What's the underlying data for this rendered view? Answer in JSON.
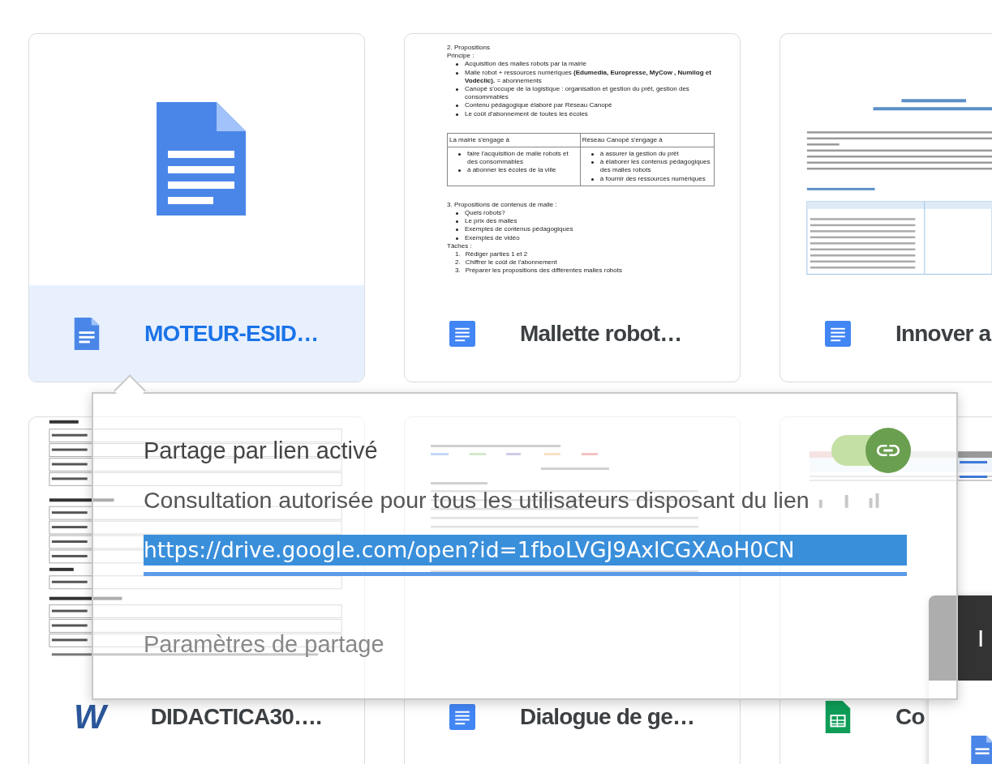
{
  "cards": [
    {
      "title": "MOTEUR-ESID…",
      "kind": "doc_file",
      "selected": true,
      "thumbnail": {
        "kind": "icon"
      }
    },
    {
      "title": "Mallette robot…",
      "kind": "docs",
      "selected": false,
      "thumbnail": {
        "kind": "document",
        "blocks": [
          {
            "kind": "text",
            "text": "2. Propositions"
          },
          {
            "kind": "text",
            "text": "Principe :"
          },
          {
            "kind": "bullet",
            "text": "Acquisition des malles robots par la mairie"
          },
          {
            "kind": "bullet",
            "text": "Malle robot + ressources numériques **(Edumedia, Europresse, MyCow , Numilog et Vodéclic).** = abonnements"
          },
          {
            "kind": "bullet",
            "text": "Canopé s'occupe de la logistique : organisation et gestion du prêt, gestion des consommables"
          },
          {
            "kind": "bullet",
            "text": "Contenu pédagogique élaboré par Réseau Canopé"
          },
          {
            "kind": "bullet",
            "text": "Le coût d'abonnement de toutes les écoles"
          },
          {
            "kind": "table",
            "header": [
              "La mairie s'engage à",
              "Réseau Canopé s'engage à"
            ],
            "rows": [
              [
                {
                  "bullets": [
                    "faire l'acquisition de malle robots et des consommables",
                    "à abonner les écoles de la ville"
                  ]
                },
                {
                  "bullets": [
                    "à assurer la gestion du prêt",
                    "à élaborer les contenus pédagogiques des malles robots",
                    "à fournir des ressources numériques"
                  ]
                }
              ]
            ]
          },
          {
            "kind": "text",
            "text": "3. Propositions de contenus de malle :"
          },
          {
            "kind": "bullet",
            "text": "Quels robots?"
          },
          {
            "kind": "bullet",
            "text": "Le prix des malles"
          },
          {
            "kind": "bullet",
            "text": "Exemples de contenus pédagogiques"
          },
          {
            "kind": "bullet",
            "text": "Exemples de vidéo"
          },
          {
            "kind": "text",
            "text": "Tâches :"
          },
          {
            "kind": "num",
            "number": "1.",
            "text": "Rédiger parties 1 et 2"
          },
          {
            "kind": "num",
            "number": "2.",
            "text": "Chiffrer le coût de l'abonnement"
          },
          {
            "kind": "num",
            "number": "3.",
            "text": "Préparer les propositions des différentes malles robots"
          }
        ]
      }
    },
    {
      "title": "Innover a",
      "kind": "docs",
      "selected": false,
      "thumbnail": {
        "kind": "report_drawing"
      }
    },
    {
      "title": "DIDACTICA30….",
      "kind": "word",
      "icon_text": "W",
      "selected": false,
      "thumbnail": {
        "kind": "form_drawing"
      }
    },
    {
      "title": "Dialogue de ge…",
      "kind": "docs",
      "selected": false,
      "thumbnail": {
        "kind": "notes_drawing"
      }
    },
    {
      "title": "Co",
      "kind": "sheets",
      "selected": false,
      "thumbnail": {
        "kind": "spreadsheet_drawing"
      }
    }
  ],
  "share_popup": {
    "title": "Partage par lien activé",
    "description": "Consultation autorisée pour tous les utilisateurs disposant du lien",
    "link_url": "https://drive.google.com/open?id=1fboLVGJ9AxlCGXAoH0CN",
    "url_selected": true,
    "link_sharing_on": true,
    "settings_link": "Paramètres de partage"
  },
  "preview_card": {
    "title": "I"
  }
}
